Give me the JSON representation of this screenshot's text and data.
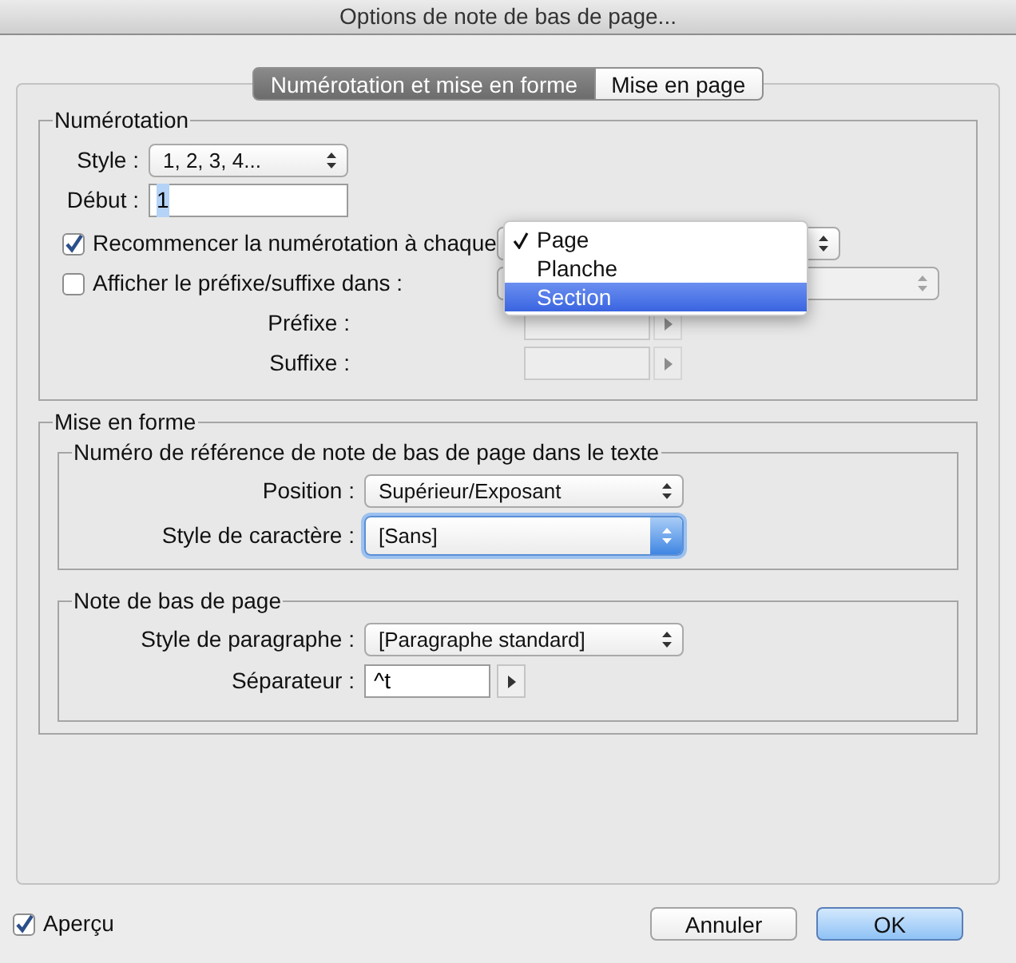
{
  "window": {
    "title": "Options de note de bas de page..."
  },
  "tabs": [
    {
      "label": "Numérotation et mise en forme",
      "selected": true
    },
    {
      "label": "Mise en page",
      "selected": false
    }
  ],
  "numbering": {
    "title": "Numérotation",
    "style": {
      "label": "Style :",
      "value": "1, 2, 3, 4..."
    },
    "start": {
      "label": "Début :",
      "value": "1"
    },
    "restart": {
      "label": "Recommencer la numérotation à chaque",
      "checked": true
    },
    "show_affix": {
      "label": "Afficher le préfixe/suffixe dans :",
      "checked": false
    },
    "prefix": {
      "label": "Préfixe :"
    },
    "suffix": {
      "label": "Suffixe :"
    },
    "menu": [
      {
        "label": "Page",
        "checked": true,
        "selected": false
      },
      {
        "label": "Planche",
        "checked": false,
        "selected": false
      },
      {
        "label": "Section",
        "checked": false,
        "selected": true
      }
    ]
  },
  "formatting": {
    "title": "Mise en forme",
    "reference": {
      "title": "Numéro de référence de note de bas de page dans le texte",
      "position": {
        "label": "Position :",
        "value": "Supérieur/Exposant"
      },
      "char_style": {
        "label": "Style de caractère :",
        "value": "[Sans]",
        "focused": true
      }
    },
    "footnote": {
      "title": "Note de bas de page",
      "para_style": {
        "label": "Style de paragraphe :",
        "value": "[Paragraphe standard]"
      },
      "separator": {
        "label": "Séparateur :",
        "value": "^t"
      }
    }
  },
  "preview": {
    "label": "Aperçu",
    "checked": true
  },
  "buttons": [
    {
      "label": "Annuler",
      "default": false
    },
    {
      "label": "OK",
      "default": true
    }
  ]
}
